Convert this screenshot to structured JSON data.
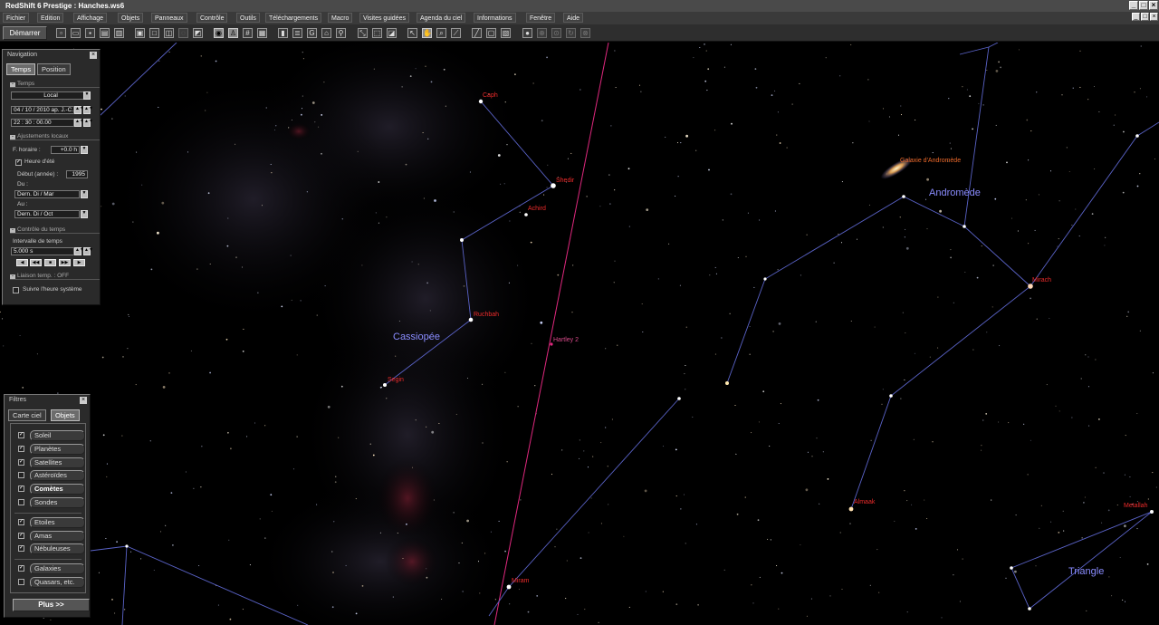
{
  "window": {
    "title": "RedShift 6 Prestige : Hanches.ws6",
    "buttons": [
      "_",
      "□",
      "×"
    ]
  },
  "menubar": {
    "items": [
      "Fichier",
      "Edition",
      "Affichage",
      "Objets",
      "Panneaux",
      "Contrôle",
      "Outils",
      "Téléchargements",
      "Macro",
      "Visites guidées",
      "Agenda du ciel",
      "Informations",
      "Fenêtre",
      "Aide"
    ],
    "mdi_buttons": [
      "_",
      "□",
      "×"
    ]
  },
  "toolbar": {
    "start_label": "Démarrer"
  },
  "navigation": {
    "title": "Navigation",
    "close": "×",
    "tabs": [
      "Temps",
      "Position"
    ],
    "temps_section": "Temps",
    "mode_value": "Local",
    "date_value": "04 / 10 / 2010 ap. J.-C.",
    "time_value": "22 : 30 : 00.00",
    "adjust_section": "Ajustements locaux",
    "tz_label": "F. horaire :",
    "tz_value": "+0.0  h",
    "dst_label": "Heure d'été",
    "start_year_label": "Début (année) :",
    "start_year_value": "1995",
    "du_label": "Du :",
    "du_value": "Dern.   Di  /  Mar",
    "au_label": "Au :",
    "au_value": "Dern.   Di  /  Oct",
    "control_section": "Contrôle du temps",
    "interval_label": "Intervalle de temps",
    "interval_value": "5.000     s",
    "playback": [
      "◀",
      "◀◀",
      "■",
      "▶▶",
      "▶"
    ],
    "link_section": "Liaison temp. : OFF",
    "system_time_label": "Suivre l'heure système"
  },
  "filters": {
    "title": "Filtres",
    "close": "×",
    "tabs": [
      "Carte ciel",
      "Objets"
    ],
    "items": [
      {
        "label": "Soleil",
        "checked": true
      },
      {
        "label": "Planètes",
        "checked": true
      },
      {
        "label": "Satellites",
        "checked": true
      },
      {
        "label": "Astéroïdes",
        "checked": false
      },
      {
        "label": "Comètes",
        "checked": true
      },
      {
        "label": "Sondes",
        "checked": false
      },
      {
        "label": "Etoiles",
        "checked": true
      },
      {
        "label": "Amas",
        "checked": true
      },
      {
        "label": "Nébuleuses",
        "checked": true
      },
      {
        "label": "Galaxies",
        "checked": true
      },
      {
        "label": "Quasars, etc.",
        "checked": false
      }
    ],
    "more_label": "Plus >>"
  },
  "sky": {
    "constellations": [
      "Cassiopée",
      "Andromède",
      "Triangle"
    ],
    "stars": [
      "Caph",
      "Shedir",
      "Achird",
      "Ruchbah",
      "Segin",
      "Mirach",
      "Almaak",
      "Metallah",
      "Miram"
    ],
    "objects": [
      "Galaxie d'Andromède",
      "Hartley 2"
    ]
  },
  "colors": {
    "constellation_line": "#5a63c8",
    "star_label": "#ee2b2b",
    "constellation_label": "#8a8cff",
    "comet_path": "#e0287e"
  }
}
